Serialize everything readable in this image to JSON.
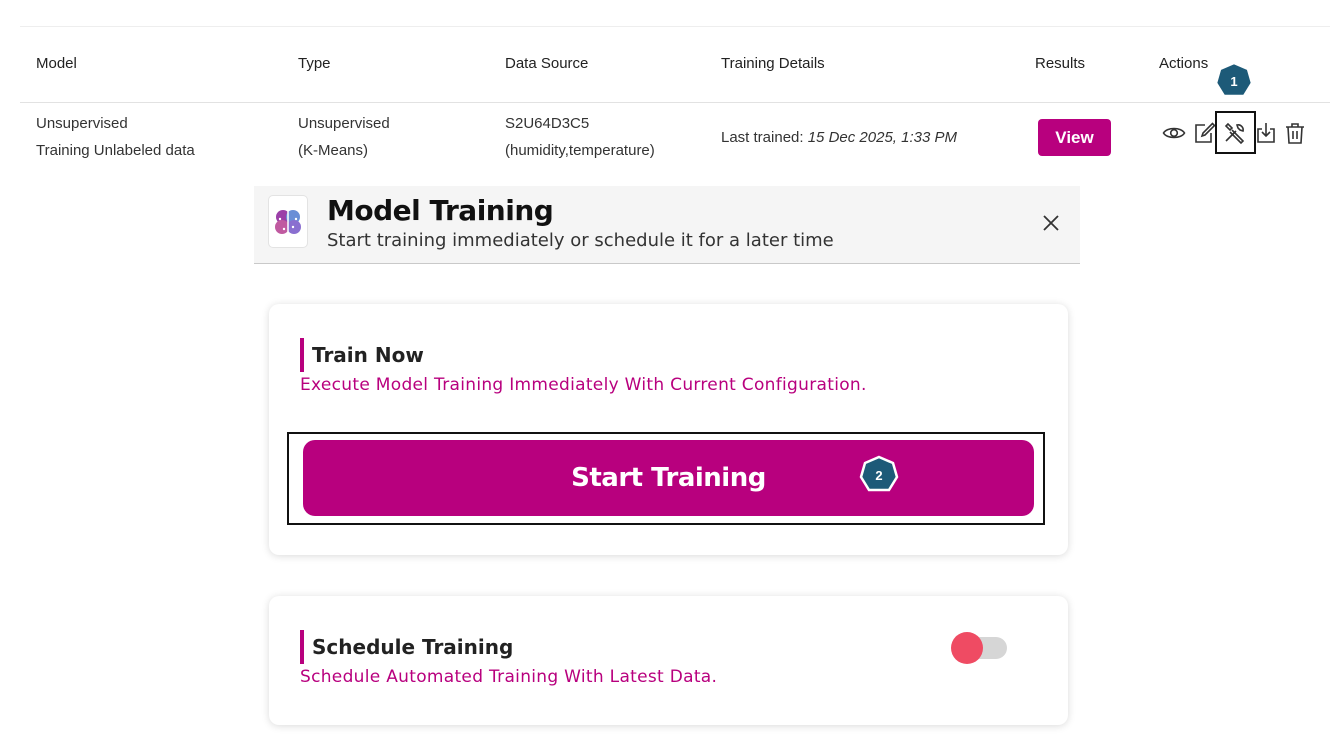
{
  "table": {
    "headers": [
      "Model",
      "Type",
      "Data Source",
      "Training Details",
      "Results",
      "Actions"
    ],
    "row": {
      "model_line1": "Unsupervised",
      "model_line2": "Training Unlabeled data",
      "type_line1": "Unsupervised",
      "type_line2": "(K-Means)",
      "source_line1": "S2U64D3C5",
      "source_line2": "(humidity,temperature)",
      "training_prefix": "Last trained: ",
      "training_value": "15 Dec 2025, 1:33 PM",
      "results_button": "View"
    },
    "action_icons": [
      "eye-icon",
      "edit-icon",
      "tools-icon",
      "download-icon",
      "trash-icon"
    ]
  },
  "badges": {
    "step1": "1",
    "step2": "2",
    "color": "#1d5a78"
  },
  "modal": {
    "title": "Model Training",
    "subtitle": "Start training immediately or schedule it for a later time",
    "logo_icon": "brain-icon",
    "close_icon": "close-icon"
  },
  "train_now": {
    "title": "Train Now",
    "description": "Execute Model Training Immediately With Current Configuration.",
    "button_label": "Start Training"
  },
  "schedule": {
    "title": "Schedule Training",
    "description": "Schedule Automated Training With Latest Data.",
    "enabled": false
  },
  "colors": {
    "accent": "#b8007e",
    "toggle_knob": "#ef4b63",
    "badge": "#1d5a78"
  }
}
